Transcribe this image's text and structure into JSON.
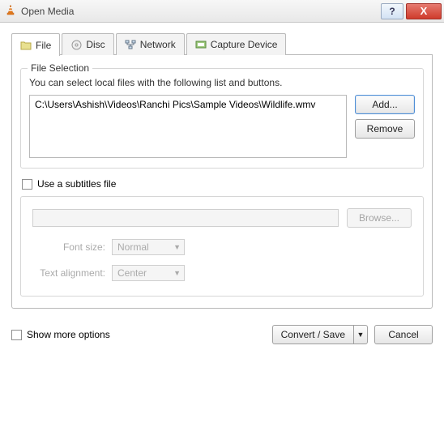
{
  "window": {
    "title": "Open Media"
  },
  "tabs": {
    "file": "File",
    "disc": "Disc",
    "network": "Network",
    "capture": "Capture Device"
  },
  "file_section": {
    "legend": "File Selection",
    "hint": "You can select local files with the following list and buttons.",
    "files": [
      "C:\\Users\\Ashish\\Videos\\Ranchi Pics\\Sample Videos\\Wildlife.wmv"
    ],
    "add": "Add...",
    "remove": "Remove"
  },
  "subtitles": {
    "use_label": "Use a subtitles file",
    "browse": "Browse...",
    "font_size_label": "Font size:",
    "font_size_value": "Normal",
    "align_label": "Text alignment:",
    "align_value": "Center"
  },
  "footer": {
    "show_more": "Show more options",
    "convert": "Convert / Save",
    "cancel": "Cancel"
  }
}
